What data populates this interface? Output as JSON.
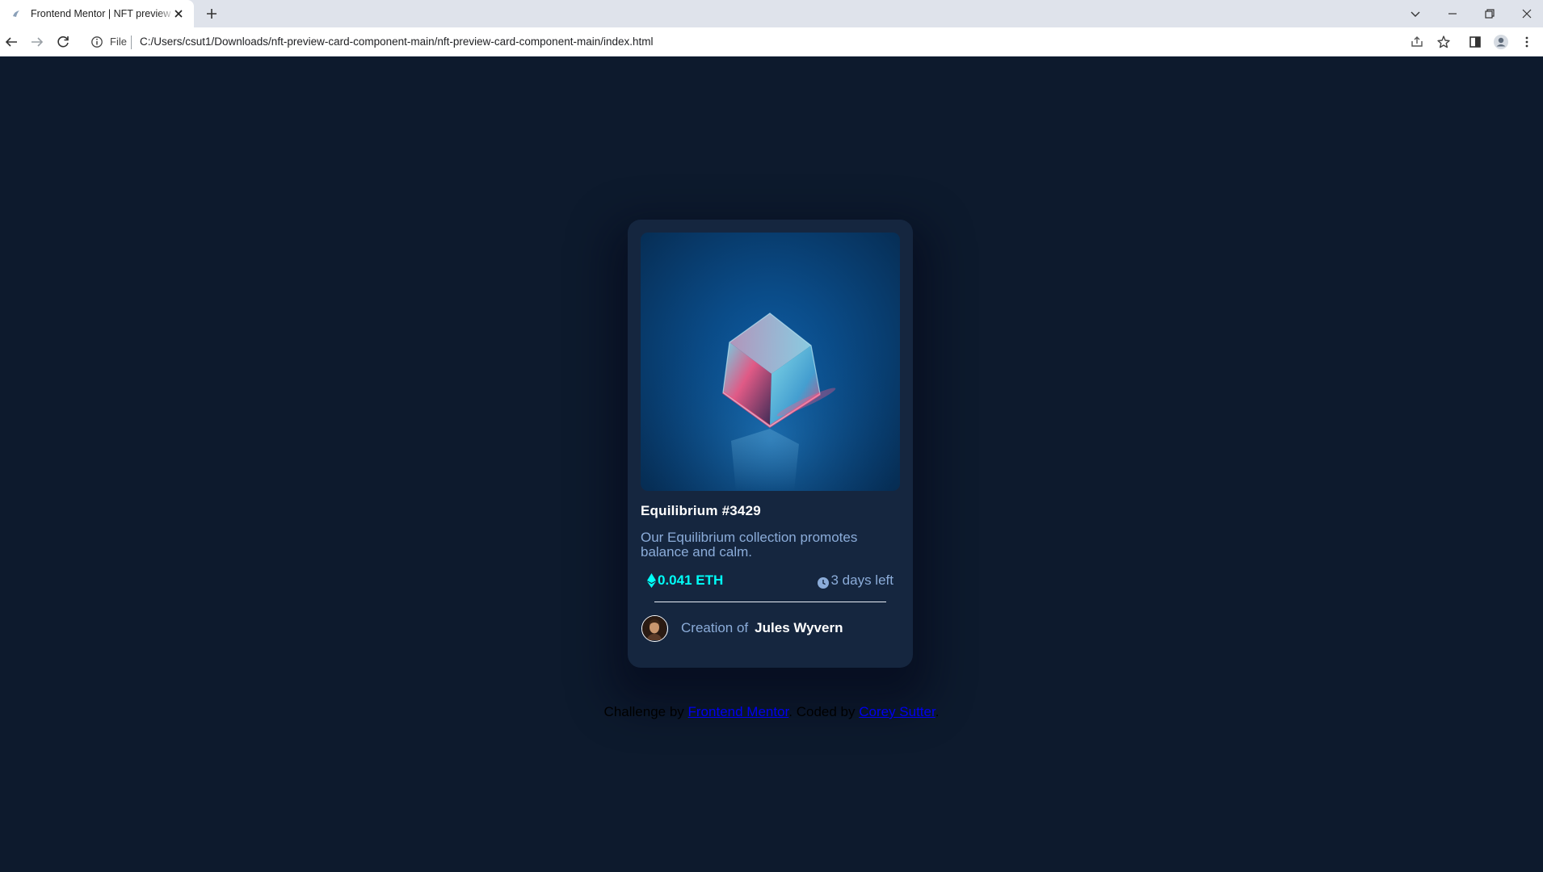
{
  "browser": {
    "tab_title": "Frontend Mentor | NFT preview card component",
    "url_scheme_label": "File",
    "url": "C:/Users/csut1/Downloads/nft-preview-card-component-main/nft-preview-card-component-main/index.html"
  },
  "card": {
    "image_alt": "Equilibrium",
    "title": "Equilibrium #3429",
    "description": "Our Equilibrium collection promotes balance and calm.",
    "price": "0.041 ETH",
    "time_left": "3 days left",
    "creator_label": "Creation of",
    "creator_name": "Jules Wyvern"
  },
  "attribution": {
    "prefix": "Challenge by ",
    "link1": "Frontend Mentor",
    "middle": ". Coded by ",
    "link2": "Corey Sutter",
    "suffix": "."
  },
  "colors": {
    "page_bg": "#0d1a2d",
    "card_bg": "#15263f",
    "cyan": "#00fff8",
    "soft_blue": "#8bacd9",
    "white": "#ffffff"
  },
  "icons": [
    "favicon-icon",
    "close-icon",
    "plus-icon",
    "chevron-down-icon",
    "minimize-icon",
    "restore-icon",
    "window-close-icon",
    "back-arrow-icon",
    "forward-arrow-icon",
    "reload-icon",
    "info-icon",
    "share-icon",
    "star-icon",
    "side-panel-icon",
    "profile-icon",
    "kebab-menu-icon",
    "ethereum-icon",
    "clock-icon"
  ]
}
